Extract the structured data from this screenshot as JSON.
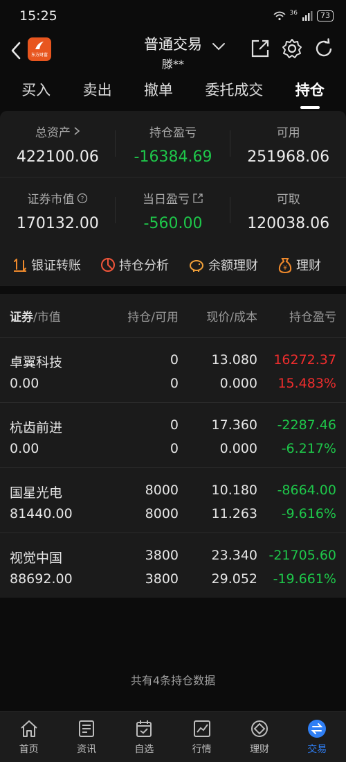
{
  "status": {
    "time": "15:25",
    "signal": "36",
    "battery": "73"
  },
  "header": {
    "logo_text": "东方财富",
    "title": "普通交易",
    "account": "滕**"
  },
  "tabs": [
    {
      "label": "买入"
    },
    {
      "label": "卖出"
    },
    {
      "label": "撤单"
    },
    {
      "label": "委托成交"
    },
    {
      "label": "持仓"
    }
  ],
  "summary": {
    "total_assets_label": "总资产",
    "total_assets": "422100.06",
    "position_pl_label": "持仓盈亏",
    "position_pl": "-16384.69",
    "available_label": "可用",
    "available": "251968.06",
    "market_value_label": "证券市值",
    "market_value": "170132.00",
    "daily_pl_label": "当日盈亏",
    "daily_pl": "-560.00",
    "withdrawable_label": "可取",
    "withdrawable": "120038.06"
  },
  "quick_actions": [
    {
      "label": "银证转账",
      "icon": "transfer-icon"
    },
    {
      "label": "持仓分析",
      "icon": "pie-chart-icon"
    },
    {
      "label": "余额理财",
      "icon": "piggy-bank-icon"
    },
    {
      "label": "理财",
      "icon": "money-bag-icon"
    }
  ],
  "table": {
    "head": {
      "security": "证券",
      "slash_mv": "/市值",
      "position": "持仓/可用",
      "price": "现价/成本",
      "pl": "持仓盈亏"
    },
    "rows": [
      {
        "name": "卓翼科技",
        "market_value": "0.00",
        "position": "0",
        "available": "0",
        "price": "13.080",
        "cost": "0.000",
        "pl": "16272.37",
        "pl_pct": "15.483%",
        "color": "#ef2d2d"
      },
      {
        "name": "杭齿前进",
        "market_value": "0.00",
        "position": "0",
        "available": "0",
        "price": "17.360",
        "cost": "0.000",
        "pl": "-2287.46",
        "pl_pct": "-6.217%",
        "color": "#1ec74a"
      },
      {
        "name": "国星光电",
        "market_value": "81440.00",
        "position": "8000",
        "available": "8000",
        "price": "10.180",
        "cost": "11.263",
        "pl": "-8664.00",
        "pl_pct": "-9.616%",
        "color": "#1ec74a"
      },
      {
        "name": "视觉中国",
        "market_value": "88692.00",
        "position": "3800",
        "available": "3800",
        "price": "23.340",
        "cost": "29.052",
        "pl": "-21705.60",
        "pl_pct": "-19.661%",
        "color": "#1ec74a"
      }
    ]
  },
  "footer_note": "共有4条持仓数据",
  "bottom_nav": [
    {
      "label": "首页",
      "icon": "home-icon"
    },
    {
      "label": "资讯",
      "icon": "news-icon"
    },
    {
      "label": "自选",
      "icon": "watchlist-icon"
    },
    {
      "label": "行情",
      "icon": "market-chart-icon"
    },
    {
      "label": "理财",
      "icon": "wealth-icon"
    },
    {
      "label": "交易",
      "icon": "trade-icon"
    }
  ],
  "colors": {
    "accent": "#2f7ff5",
    "up": "#ef2d2d",
    "down": "#1ec74a",
    "brand": "#e8561f"
  }
}
